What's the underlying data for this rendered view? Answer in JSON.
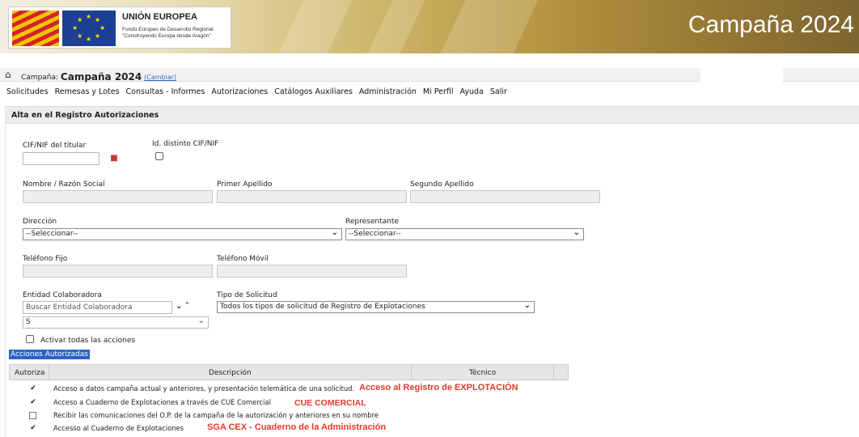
{
  "banner": {
    "eu_title": "UNIÓN EUROPEA",
    "eu_line1": "Fondo Europeo de Desarrollo Regional",
    "eu_line2": "\"Construyendo Europa desde Aragón\"",
    "campaign": "Campaña 2024"
  },
  "campbar": {
    "label": "Campaña:",
    "value": "Campaña 2024",
    "change": "(Cambiar)"
  },
  "menu": [
    "Solicitudes",
    "Remesas y Lotes",
    "Consultas - Informes",
    "Autorizaciones",
    "Catálogos Auxiliares",
    "Administración",
    "Mi Perfil",
    "Ayuda",
    "Salir"
  ],
  "section_title": "Alta en el Registro Autorizaciones",
  "form": {
    "cif_label": "CIF/NIF del titular",
    "id_distinto_label": "Id. distinto CIF/NIF",
    "nombre_label": "Nombre / Razón Social",
    "primer_label": "Primer Apellido",
    "segundo_label": "Segundo Apellido",
    "direccion_label": "Dirección",
    "direccion_value": "--Seleccionar--",
    "representante_label": "Representante",
    "representante_value": "--Seleccionar--",
    "tel_fijo_label": "Teléfono Fijo",
    "tel_movil_label": "Teléfono Móvil",
    "entidad_label": "Entidad Colaboradora",
    "entidad_placeholder": "Buscar Entidad Colaboradora",
    "entidad_select_value": "S",
    "tipo_label": "Tipo de Solicitud",
    "tipo_value": "Todos los tipos de solicitud de Registro de Explotaciones",
    "activar_label": "Activar todas las acciones"
  },
  "acciones": {
    "title": "Acciones Autorizadas",
    "headers": [
      "Autoriza",
      "Descripción",
      "Técnico"
    ],
    "rows": [
      {
        "checked": true,
        "desc": "Acceso a datos campaña actual y anteriores, y presentación telemática de una solicitud.",
        "note": "Acceso al Registro de EXPLOTACIÓN"
      },
      {
        "checked": true,
        "desc": "Acceso a Cuaderno de Explotaciones a través de CUE Comercial",
        "note": "CUE COMERCIAL"
      },
      {
        "checked": false,
        "desc": "Recibir las comunicaciones del O.P. de la campaña de la autorización y anteriores en su nombre",
        "note": ""
      },
      {
        "checked": true,
        "desc": "Accesso al Cuaderno de Explotaciones",
        "note": "SGA CEX - Cuaderno de la Administración"
      }
    ]
  }
}
